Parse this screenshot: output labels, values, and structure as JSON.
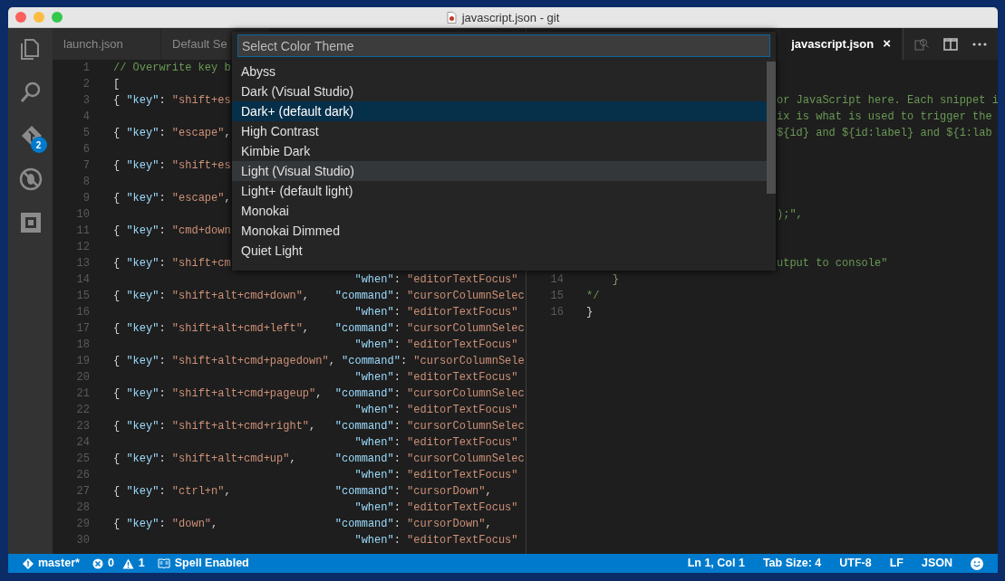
{
  "window": {
    "title": "javascript.json - git"
  },
  "activity_bar": {
    "items": [
      {
        "kind": "files",
        "selected": false
      },
      {
        "kind": "search",
        "selected": false
      },
      {
        "kind": "git",
        "selected": false,
        "badge": "2"
      },
      {
        "kind": "debug",
        "selected": false
      },
      {
        "kind": "extensions",
        "selected": false
      }
    ]
  },
  "left_tabs": [
    {
      "label": "launch.json",
      "selected": false
    },
    {
      "label": "Default Se",
      "selected": false
    }
  ],
  "right_tabs": [
    {
      "label": "javascript.json",
      "selected": true,
      "close": "×"
    }
  ],
  "left_editor": {
    "lines": [
      {
        "number": "1",
        "segments": [
          {
            "kind": "comment",
            "text": "// Overwrite key b"
          }
        ]
      },
      {
        "number": "2",
        "segments": [
          {
            "kind": "punct",
            "text": "["
          }
        ]
      },
      {
        "number": "3",
        "segments": [
          {
            "kind": "punct",
            "text": "{ "
          },
          {
            "kind": "key",
            "text": "\"key\""
          },
          {
            "kind": "punct",
            "text": ": "
          },
          {
            "kind": "string",
            "text": "\"shift+es"
          }
        ]
      },
      {
        "number": "4"
      },
      {
        "number": "5",
        "segments": [
          {
            "kind": "punct",
            "text": "{ "
          },
          {
            "kind": "key",
            "text": "\"key\""
          },
          {
            "kind": "punct",
            "text": ": "
          },
          {
            "kind": "string",
            "text": "\"escape\""
          },
          {
            "kind": "punct",
            "text": ","
          }
        ]
      },
      {
        "number": "6"
      },
      {
        "number": "7",
        "segments": [
          {
            "kind": "punct",
            "text": "{ "
          },
          {
            "kind": "key",
            "text": "\"key\""
          },
          {
            "kind": "punct",
            "text": ": "
          },
          {
            "kind": "string",
            "text": "\"shift+es"
          }
        ]
      },
      {
        "number": "8"
      },
      {
        "number": "9",
        "segments": [
          {
            "kind": "punct",
            "text": "{ "
          },
          {
            "kind": "key",
            "text": "\"key\""
          },
          {
            "kind": "punct",
            "text": ": "
          },
          {
            "kind": "string",
            "text": "\"escape\""
          },
          {
            "kind": "punct",
            "text": ","
          }
        ]
      },
      {
        "number": "10"
      },
      {
        "number": "11",
        "segments": [
          {
            "kind": "punct",
            "text": "{ "
          },
          {
            "kind": "key",
            "text": "\"key\""
          },
          {
            "kind": "punct",
            "text": ": "
          },
          {
            "kind": "string",
            "text": "\"cmd+down"
          }
        ]
      },
      {
        "number": "12"
      },
      {
        "number": "13",
        "segments": [
          {
            "kind": "punct",
            "text": "{ "
          },
          {
            "kind": "key",
            "text": "\"key\""
          },
          {
            "kind": "punct",
            "text": ": "
          },
          {
            "kind": "string",
            "text": "\"shift+cm"
          }
        ]
      },
      {
        "number": "14",
        "segments": [
          {
            "kind": "key",
            "text": "                                     \"when\""
          },
          {
            "kind": "punct",
            "text": ": "
          },
          {
            "kind": "string",
            "text": "\"editorTextFocus\""
          }
        ]
      },
      {
        "number": "15",
        "segments": [
          {
            "kind": "punct",
            "text": "{ "
          },
          {
            "kind": "key",
            "text": "\"key\""
          },
          {
            "kind": "punct",
            "text": ": "
          },
          {
            "kind": "string",
            "text": "\"shift+alt+cmd+down\""
          },
          {
            "kind": "punct",
            "text": ","
          },
          {
            "kind": "key",
            "text": "    \"command\""
          },
          {
            "kind": "punct",
            "text": ": "
          },
          {
            "kind": "string",
            "text": "\"cursorColumnSelec"
          }
        ]
      },
      {
        "number": "16",
        "segments": [
          {
            "kind": "key",
            "text": "                                     \"when\""
          },
          {
            "kind": "punct",
            "text": ": "
          },
          {
            "kind": "string",
            "text": "\"editorTextFocus\""
          }
        ]
      },
      {
        "number": "17",
        "segments": [
          {
            "kind": "punct",
            "text": "{ "
          },
          {
            "kind": "key",
            "text": "\"key\""
          },
          {
            "kind": "punct",
            "text": ": "
          },
          {
            "kind": "string",
            "text": "\"shift+alt+cmd+left\""
          },
          {
            "kind": "punct",
            "text": ","
          },
          {
            "kind": "key",
            "text": "    \"command\""
          },
          {
            "kind": "punct",
            "text": ": "
          },
          {
            "kind": "string",
            "text": "\"cursorColumnSelec"
          }
        ]
      },
      {
        "number": "18",
        "segments": [
          {
            "kind": "key",
            "text": "                                     \"when\""
          },
          {
            "kind": "punct",
            "text": ": "
          },
          {
            "kind": "string",
            "text": "\"editorTextFocus\""
          }
        ]
      },
      {
        "number": "19",
        "segments": [
          {
            "kind": "punct",
            "text": "{ "
          },
          {
            "kind": "key",
            "text": "\"key\""
          },
          {
            "kind": "punct",
            "text": ": "
          },
          {
            "kind": "string",
            "text": "\"shift+alt+cmd+pagedown\""
          },
          {
            "kind": "punct",
            "text": ","
          },
          {
            "kind": "key",
            "text": " \"command\""
          },
          {
            "kind": "punct",
            "text": ": "
          },
          {
            "kind": "string",
            "text": "\"cursorColumnSele"
          }
        ]
      },
      {
        "number": "20",
        "segments": [
          {
            "kind": "key",
            "text": "                                     \"when\""
          },
          {
            "kind": "punct",
            "text": ": "
          },
          {
            "kind": "string",
            "text": "\"editorTextFocus\""
          }
        ]
      },
      {
        "number": "21",
        "segments": [
          {
            "kind": "punct",
            "text": "{ "
          },
          {
            "kind": "key",
            "text": "\"key\""
          },
          {
            "kind": "punct",
            "text": ": "
          },
          {
            "kind": "string",
            "text": "\"shift+alt+cmd+pageup\""
          },
          {
            "kind": "punct",
            "text": ","
          },
          {
            "kind": "key",
            "text": "  \"command\""
          },
          {
            "kind": "punct",
            "text": ": "
          },
          {
            "kind": "string",
            "text": "\"cursorColumnSelec"
          }
        ]
      },
      {
        "number": "22",
        "segments": [
          {
            "kind": "key",
            "text": "                                     \"when\""
          },
          {
            "kind": "punct",
            "text": ": "
          },
          {
            "kind": "string",
            "text": "\"editorTextFocus\""
          }
        ]
      },
      {
        "number": "23",
        "segments": [
          {
            "kind": "punct",
            "text": "{ "
          },
          {
            "kind": "key",
            "text": "\"key\""
          },
          {
            "kind": "punct",
            "text": ": "
          },
          {
            "kind": "string",
            "text": "\"shift+alt+cmd+right\""
          },
          {
            "kind": "punct",
            "text": ","
          },
          {
            "kind": "key",
            "text": "   \"command\""
          },
          {
            "kind": "punct",
            "text": ": "
          },
          {
            "kind": "string",
            "text": "\"cursorColumnSelec"
          }
        ]
      },
      {
        "number": "24",
        "segments": [
          {
            "kind": "key",
            "text": "                                     \"when\""
          },
          {
            "kind": "punct",
            "text": ": "
          },
          {
            "kind": "string",
            "text": "\"editorTextFocus\""
          }
        ]
      },
      {
        "number": "25",
        "segments": [
          {
            "kind": "punct",
            "text": "{ "
          },
          {
            "kind": "key",
            "text": "\"key\""
          },
          {
            "kind": "punct",
            "text": ": "
          },
          {
            "kind": "string",
            "text": "\"shift+alt+cmd+up\""
          },
          {
            "kind": "punct",
            "text": ","
          },
          {
            "kind": "key",
            "text": "      \"command\""
          },
          {
            "kind": "punct",
            "text": ": "
          },
          {
            "kind": "string",
            "text": "\"cursorColumnSelec"
          }
        ]
      },
      {
        "number": "26",
        "segments": [
          {
            "kind": "key",
            "text": "                                     \"when\""
          },
          {
            "kind": "punct",
            "text": ": "
          },
          {
            "kind": "string",
            "text": "\"editorTextFocus\""
          }
        ]
      },
      {
        "number": "27",
        "segments": [
          {
            "kind": "punct",
            "text": "{ "
          },
          {
            "kind": "key",
            "text": "\"key\""
          },
          {
            "kind": "punct",
            "text": ": "
          },
          {
            "kind": "string",
            "text": "\"ctrl+n\""
          },
          {
            "kind": "punct",
            "text": ","
          },
          {
            "kind": "key",
            "text": "                \"command\""
          },
          {
            "kind": "punct",
            "text": ": "
          },
          {
            "kind": "string",
            "text": "\"cursorDown\""
          },
          {
            "kind": "punct",
            "text": ","
          }
        ]
      },
      {
        "number": "28",
        "segments": [
          {
            "kind": "key",
            "text": "                                     \"when\""
          },
          {
            "kind": "punct",
            "text": ": "
          },
          {
            "kind": "string",
            "text": "\"editorTextFocus\""
          }
        ]
      },
      {
        "number": "29",
        "segments": [
          {
            "kind": "punct",
            "text": "{ "
          },
          {
            "kind": "key",
            "text": "\"key\""
          },
          {
            "kind": "punct",
            "text": ": "
          },
          {
            "kind": "string",
            "text": "\"down\""
          },
          {
            "kind": "punct",
            "text": ","
          },
          {
            "kind": "key",
            "text": "                  \"command\""
          },
          {
            "kind": "punct",
            "text": ": "
          },
          {
            "kind": "string",
            "text": "\"cursorDown\""
          },
          {
            "kind": "punct",
            "text": ","
          }
        ]
      },
      {
        "number": "30",
        "segments": [
          {
            "kind": "key",
            "text": "                                     \"when\""
          },
          {
            "kind": "punct",
            "text": ": "
          },
          {
            "kind": "string",
            "text": "\"editorTextFocus\""
          }
        ]
      }
    ]
  },
  "right_editor": {
    "lines": [
      {
        "kind": "covered"
      },
      {
        "kind": "covered"
      },
      {
        "kind": "clipped",
        "text": "or JavaScript here. Each snippet i"
      },
      {
        "kind": "clipped",
        "text": "ix is what is used to trigger the"
      },
      {
        "kind": "clipped",
        "text": "${id} and ${id:label} and ${1:lab"
      },
      {
        "kind": "covered"
      },
      {
        "kind": "covered"
      },
      {
        "kind": "covered"
      },
      {
        "kind": "covered"
      },
      {
        "kind": "clipped",
        "text": ");\","
      },
      {
        "kind": "covered"
      },
      {
        "kind": "covered"
      },
      {
        "kind": "clipped",
        "text": "utput to console\""
      },
      {
        "kind": "brace",
        "number": "14",
        "text": "    }"
      },
      {
        "kind": "comment",
        "number": "15",
        "text": "*/"
      },
      {
        "kind": "punct",
        "number": "16",
        "text": "}"
      }
    ]
  },
  "quick_pick": {
    "placeholder": "Select Color Theme",
    "items": [
      {
        "label": "Abyss",
        "selected": false,
        "hovered": false
      },
      {
        "label": "Dark (Visual Studio)",
        "selected": false,
        "hovered": false
      },
      {
        "label": "Dark+ (default dark)",
        "selected": true,
        "hovered": false
      },
      {
        "label": "High Contrast",
        "selected": false,
        "hovered": false
      },
      {
        "label": "Kimbie Dark",
        "selected": false,
        "hovered": false
      },
      {
        "label": "Light (Visual Studio)",
        "selected": false,
        "hovered": true
      },
      {
        "label": "Light+ (default light)",
        "selected": false,
        "hovered": false
      },
      {
        "label": "Monokai",
        "selected": false,
        "hovered": false
      },
      {
        "label": "Monokai Dimmed",
        "selected": false,
        "hovered": false
      },
      {
        "label": "Quiet Light",
        "selected": false,
        "hovered": false
      }
    ]
  },
  "status_bar": {
    "branch": "master*",
    "errors": "0",
    "warnings": "1",
    "spell": "Spell Enabled",
    "right": [
      "Ln 1, Col 1",
      "Tab Size: 4",
      "UTF-8",
      "LF",
      "JSON"
    ]
  }
}
